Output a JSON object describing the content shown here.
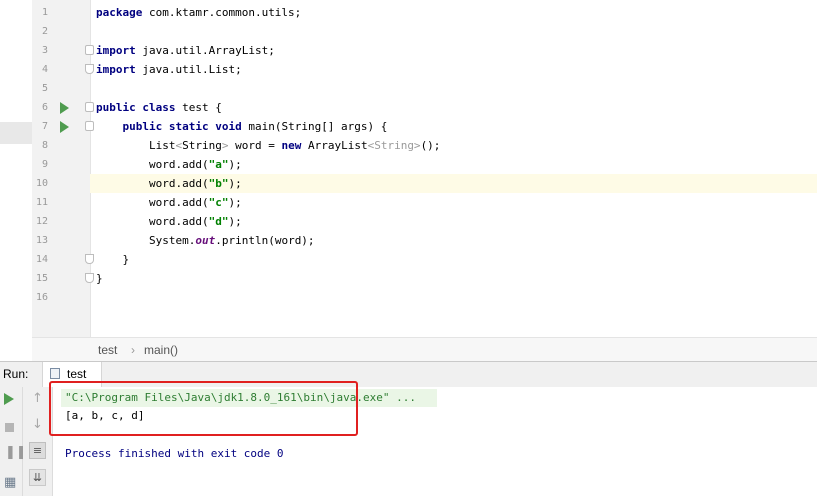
{
  "editor": {
    "lines": [
      {
        "no": "1",
        "segments": [
          {
            "t": "package",
            "c": "kw"
          },
          {
            "t": " com.ktamr.common.utils;",
            "c": ""
          }
        ]
      },
      {
        "no": "2",
        "segments": []
      },
      {
        "no": "3",
        "segments": [
          {
            "t": "import",
            "c": "kw"
          },
          {
            "t": " java.util.ArrayList;",
            "c": ""
          }
        ]
      },
      {
        "no": "4",
        "segments": [
          {
            "t": "import",
            "c": "kw"
          },
          {
            "t": " java.util.List;",
            "c": ""
          }
        ]
      },
      {
        "no": "5",
        "segments": []
      },
      {
        "no": "6",
        "segments": [
          {
            "t": "public class",
            "c": "kw"
          },
          {
            "t": " test {",
            "c": ""
          }
        ]
      },
      {
        "no": "7",
        "segments": [
          {
            "t": "    ",
            "c": ""
          },
          {
            "t": "public static void",
            "c": "kw"
          },
          {
            "t": " main(String[] args) {",
            "c": ""
          }
        ]
      },
      {
        "no": "8",
        "segments": [
          {
            "t": "        List",
            "c": ""
          },
          {
            "t": "<",
            "c": "gen"
          },
          {
            "t": "String",
            "c": ""
          },
          {
            "t": ">",
            "c": "gen"
          },
          {
            "t": " word = ",
            "c": ""
          },
          {
            "t": "new",
            "c": "kw"
          },
          {
            "t": " ArrayList",
            "c": ""
          },
          {
            "t": "<String>",
            "c": "gen"
          },
          {
            "t": "();",
            "c": ""
          }
        ]
      },
      {
        "no": "9",
        "segments": [
          {
            "t": "        word.add(",
            "c": ""
          },
          {
            "t": "\"a\"",
            "c": "str"
          },
          {
            "t": ");",
            "c": ""
          }
        ]
      },
      {
        "no": "10",
        "segments": [
          {
            "t": "        word.add(",
            "c": ""
          },
          {
            "t": "\"b\"",
            "c": "str"
          },
          {
            "t": ");",
            "c": ""
          }
        ]
      },
      {
        "no": "11",
        "segments": [
          {
            "t": "        word.add(",
            "c": ""
          },
          {
            "t": "\"c\"",
            "c": "str"
          },
          {
            "t": ");",
            "c": ""
          }
        ]
      },
      {
        "no": "12",
        "segments": [
          {
            "t": "        word.add(",
            "c": ""
          },
          {
            "t": "\"d\"",
            "c": "str"
          },
          {
            "t": ");",
            "c": ""
          }
        ]
      },
      {
        "no": "13",
        "segments": [
          {
            "t": "        System.",
            "c": ""
          },
          {
            "t": "out",
            "c": "fld"
          },
          {
            "t": ".println(word);",
            "c": ""
          }
        ]
      },
      {
        "no": "14",
        "segments": [
          {
            "t": "    }",
            "c": ""
          }
        ]
      },
      {
        "no": "15",
        "segments": [
          {
            "t": "}",
            "c": ""
          }
        ]
      },
      {
        "no": "16",
        "segments": []
      }
    ],
    "current_line": "10"
  },
  "breadcrumb": {
    "class_name": "test",
    "separator": "›",
    "method_name": "main()"
  },
  "run_panel": {
    "label": "Run:",
    "tab_label": "test",
    "console": {
      "command": "\"C:\\Program Files\\Java\\jdk1.8.0_161\\bin\\java.exe\" ...",
      "output": "[a, b, c, d]",
      "exit_message": "Process finished with exit code 0"
    }
  },
  "colors": {
    "keyword": "#000080",
    "string": "#008000",
    "current_line": "#fefbe6",
    "run_arrow": "#4f9c4f",
    "highlight_box": "#e02020"
  }
}
